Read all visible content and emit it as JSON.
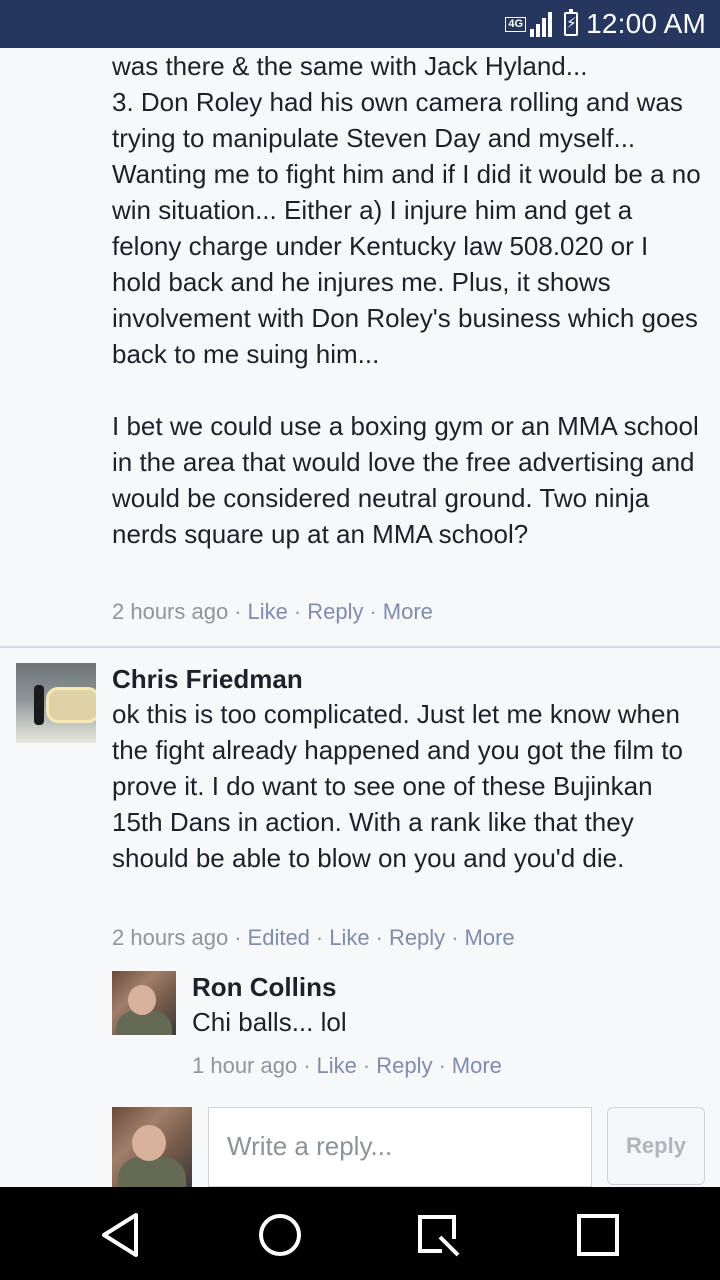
{
  "status_bar": {
    "network": "4G",
    "time": "12:00 AM"
  },
  "comments": [
    {
      "text": "was there & the same with Jack Hyland...\n3. Don Roley had his own camera rolling and was trying to manipulate Steven Day and myself... Wanting me to fight him and if I did it would be a no win situation... Either a) I injure him and get a felony charge under Kentucky law 508.020 or I hold back and he injures me. Plus, it shows involvement with Don Roley's business which goes back to me suing him...\n\nI bet we could use a boxing gym or an MMA school in the area that would love the free advertising and would be considered neutral ground. Two ninja nerds square up at an MMA school?",
      "time": "2 hours ago",
      "like": "Like",
      "reply": "Reply",
      "more": "More"
    },
    {
      "author": "Chris Friedman",
      "text": "ok this is too complicated. Just let me know when the fight already happened and you got the film to prove it. I do want to see one of these Bujinkan 15th Dans in action. With a rank like that they should be able to blow on you and you'd die.",
      "time": "2 hours ago",
      "edited": "Edited",
      "like": "Like",
      "reply": "Reply",
      "more": "More"
    },
    {
      "author": "Ron Collins",
      "text": "Chi balls... lol",
      "time": "1 hour ago",
      "like": "Like",
      "reply": "Reply",
      "more": "More"
    }
  ],
  "composer": {
    "placeholder": "Write a reply...",
    "button": "Reply"
  }
}
